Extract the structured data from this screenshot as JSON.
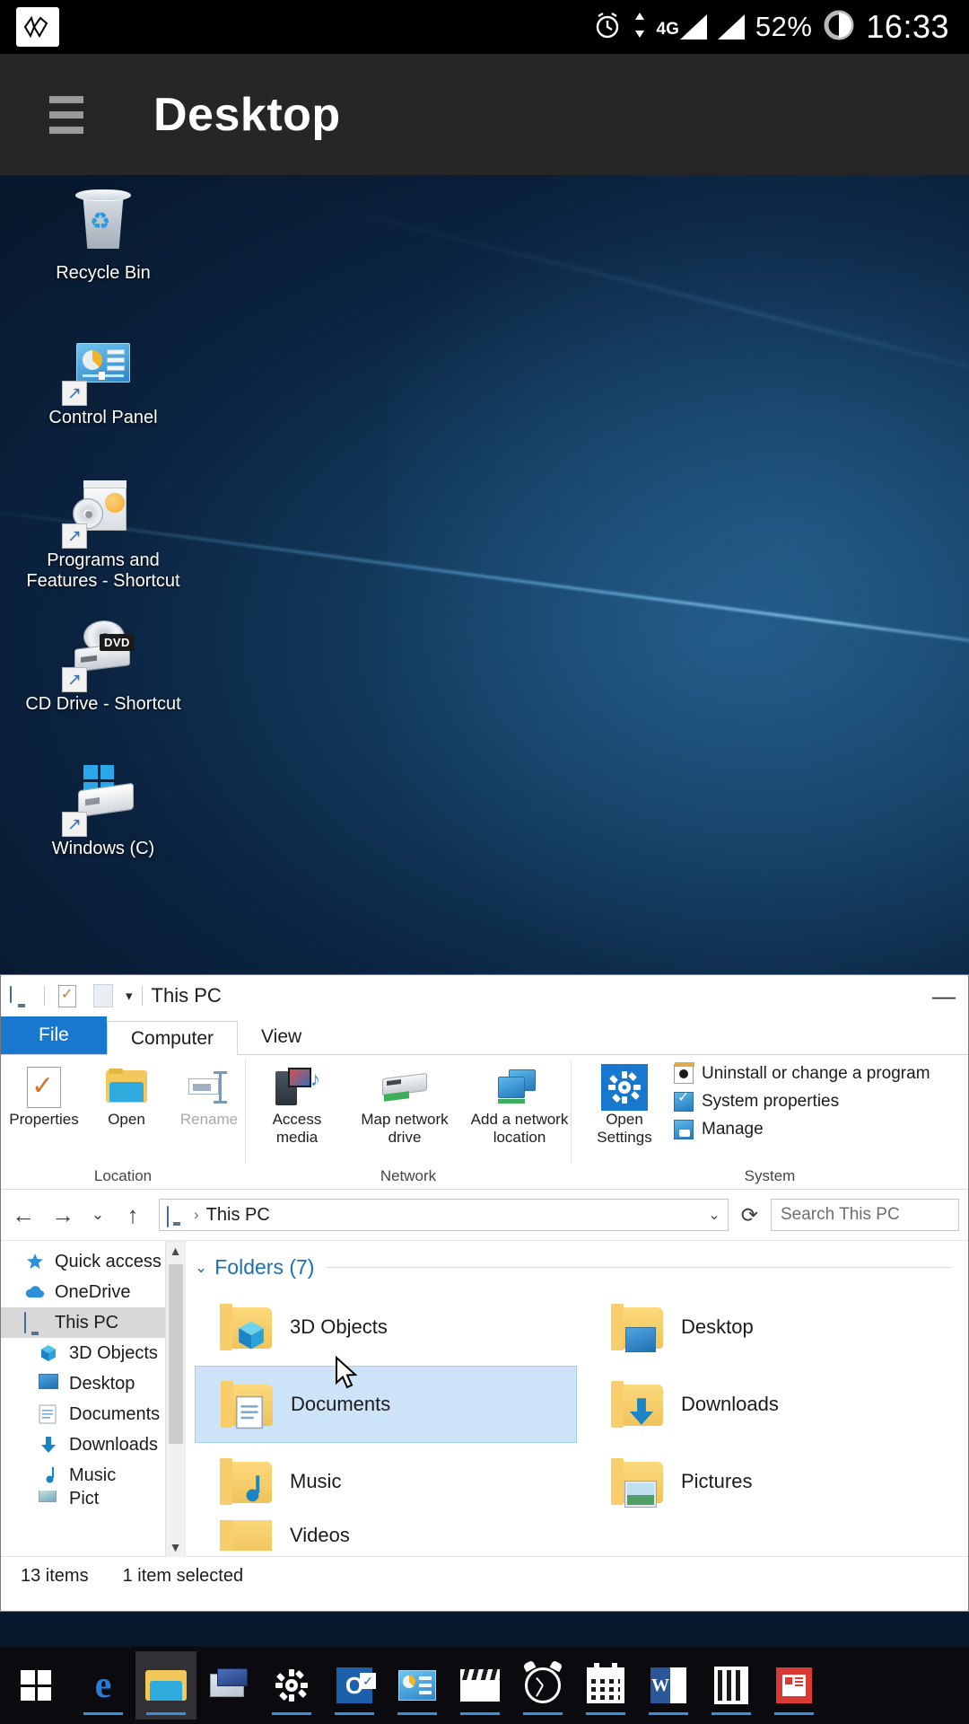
{
  "android_status_bar": {
    "app_badge_icon": "app-logo-icon",
    "alarm_icon": "alarm-clock-icon",
    "data_arrows_icon": "data-transfer-icon",
    "network_type": "4G",
    "signal_icon": "signal-bars-icon",
    "signal2_icon": "signal-bars-icon",
    "battery_percent": "52%",
    "battery_icon": "battery-circle-icon",
    "time": "16:33"
  },
  "app_header": {
    "menu_icon": "hamburger-menu-icon",
    "title": "Desktop"
  },
  "desktop": {
    "icons": [
      {
        "label": "Recycle Bin",
        "icon": "recycle-bin-icon",
        "shortcut": false
      },
      {
        "label": "Control Panel",
        "icon": "control-panel-icon",
        "shortcut": true
      },
      {
        "label": "Programs and Features - Shortcut",
        "icon": "programs-and-features-icon",
        "shortcut": true
      },
      {
        "label": "CD Drive - Shortcut",
        "icon": "cd-drive-icon",
        "shortcut": true,
        "badge": "DVD"
      },
      {
        "label": "Windows (C)",
        "icon": "windows-drive-icon",
        "shortcut": true
      }
    ]
  },
  "explorer": {
    "titlebar": {
      "quick_access_icons": [
        "this-pc-icon",
        "properties-icon",
        "new-folder-icon"
      ],
      "dropdown_icon": "chevron-down-icon",
      "title": "This PC",
      "minimize_label": "—"
    },
    "tabs": [
      {
        "label": "File",
        "type": "file"
      },
      {
        "label": "Computer",
        "type": "active"
      },
      {
        "label": "View",
        "type": "normal"
      }
    ],
    "ribbon": {
      "groups": [
        {
          "label": "Location",
          "buttons": [
            {
              "label": "Properties",
              "icon": "properties-icon",
              "disabled": false
            },
            {
              "label": "Open",
              "icon": "open-folder-icon",
              "disabled": false
            },
            {
              "label": "Rename",
              "icon": "rename-icon",
              "disabled": true
            }
          ]
        },
        {
          "label": "Network",
          "buttons": [
            {
              "label": "Access media",
              "icon": "access-media-icon",
              "dropdown": true
            },
            {
              "label": "Map network drive",
              "icon": "map-network-drive-icon",
              "dropdown": true
            },
            {
              "label": "Add a network location",
              "icon": "add-network-location-icon",
              "dropdown": false
            }
          ]
        },
        {
          "label": "System",
          "big_button": {
            "label": "Open Settings",
            "icon": "settings-gear-icon"
          },
          "list": [
            {
              "label": "Uninstall or change a program",
              "icon": "uninstall-program-icon"
            },
            {
              "label": "System properties",
              "icon": "system-properties-icon"
            },
            {
              "label": "Manage",
              "icon": "manage-icon"
            }
          ]
        }
      ]
    },
    "address_bar": {
      "back_icon": "arrow-left-icon",
      "forward_icon": "arrow-right-icon",
      "recent_icon": "chevron-down-icon",
      "up_icon": "arrow-up-icon",
      "path_icon": "this-pc-icon",
      "path_separator": "›",
      "path": "This PC",
      "dropdown_icon": "chevron-down-icon",
      "refresh_icon": "refresh-icon",
      "search_placeholder": "Search This PC"
    },
    "nav_pane": {
      "items": [
        {
          "label": "Quick access",
          "icon": "quick-access-star-icon",
          "level": 0,
          "selected": false
        },
        {
          "label": "OneDrive",
          "icon": "onedrive-cloud-icon",
          "level": 0,
          "selected": false
        },
        {
          "label": "This PC",
          "icon": "this-pc-icon",
          "level": 0,
          "selected": true
        },
        {
          "label": "3D Objects",
          "icon": "3d-objects-icon",
          "level": 1,
          "selected": false
        },
        {
          "label": "Desktop",
          "icon": "desktop-icon",
          "level": 1,
          "selected": false
        },
        {
          "label": "Documents",
          "icon": "documents-icon",
          "level": 1,
          "selected": false
        },
        {
          "label": "Downloads",
          "icon": "downloads-icon",
          "level": 1,
          "selected": false
        },
        {
          "label": "Music",
          "icon": "music-icon",
          "level": 1,
          "selected": false
        },
        {
          "label": "Pict",
          "icon": "pictures-icon",
          "level": 1,
          "selected": false
        }
      ],
      "scroll_up_icon": "scroll-up-arrow-icon",
      "scroll_down_icon": "scroll-down-arrow-icon"
    },
    "content": {
      "group_label": "Folders (7)",
      "group_caret_icon": "chevron-down-icon",
      "tiles": [
        {
          "label": "3D Objects",
          "icon": "3d-objects-folder-icon",
          "selected": false
        },
        {
          "label": "Desktop",
          "icon": "desktop-folder-icon",
          "selected": false
        },
        {
          "label": "Documents",
          "icon": "documents-folder-icon",
          "selected": true
        },
        {
          "label": "Downloads",
          "icon": "downloads-folder-icon",
          "selected": false
        },
        {
          "label": "Music",
          "icon": "music-folder-icon",
          "selected": false
        },
        {
          "label": "Pictures",
          "icon": "pictures-folder-icon",
          "selected": false
        },
        {
          "label": "Videos",
          "icon": "videos-folder-icon",
          "selected": false
        }
      ]
    },
    "status": {
      "item_count": "13 items",
      "selection": "1 item selected"
    }
  },
  "taskbar": {
    "items": [
      {
        "name": "start-button",
        "icon": "windows-start-icon",
        "running": false,
        "active": false
      },
      {
        "name": "edge-button",
        "icon": "edge-browser-icon",
        "running": true,
        "active": false
      },
      {
        "name": "file-explorer-button",
        "icon": "file-explorer-icon",
        "running": true,
        "active": true
      },
      {
        "name": "remote-desktop-button",
        "icon": "remote-desktop-icon",
        "running": false,
        "active": false
      },
      {
        "name": "settings-button",
        "icon": "settings-gear-icon",
        "running": true,
        "active": false
      },
      {
        "name": "outlook-button",
        "icon": "outlook-icon",
        "running": true,
        "active": false
      },
      {
        "name": "control-panel-button",
        "icon": "control-panel-icon",
        "running": true,
        "active": false
      },
      {
        "name": "movies-tv-button",
        "icon": "movies-tv-icon",
        "running": true,
        "active": false
      },
      {
        "name": "alarms-clock-button",
        "icon": "alarm-clock-icon",
        "running": true,
        "active": false
      },
      {
        "name": "calendar-button",
        "icon": "calendar-icon",
        "running": true,
        "active": false
      },
      {
        "name": "word-button",
        "icon": "word-icon",
        "running": true,
        "active": false
      },
      {
        "name": "calculator-button",
        "icon": "calculator-icon",
        "running": true,
        "active": false
      },
      {
        "name": "news-button",
        "icon": "news-icon",
        "running": true,
        "active": false
      }
    ]
  }
}
